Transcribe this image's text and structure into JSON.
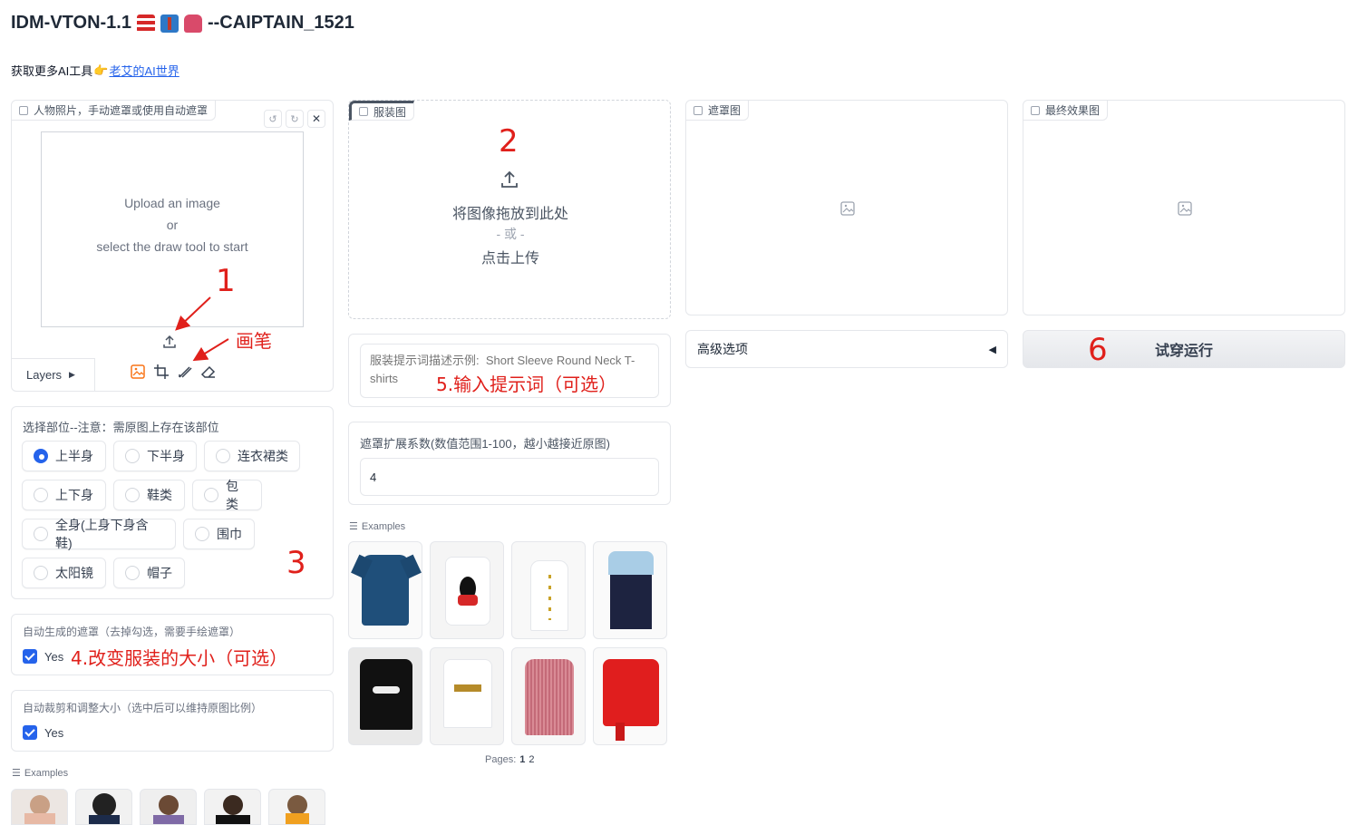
{
  "header": {
    "title": "IDM-VTON-1.1",
    "title_suffix": "--CAIPTAIN_1521",
    "subtitle_prefix": "获取更多AI工具",
    "subtitle_link": "老艾的AI世界"
  },
  "person_panel": {
    "label": "人物照片，手动遮罩或使用自动遮罩",
    "upload_line1": "Upload an image",
    "upload_line2": "or",
    "upload_line3": "select the draw tool to start",
    "layers_label": "Layers"
  },
  "garment_panel": {
    "label": "服装图",
    "drop_text": "将图像拖放到此处",
    "or_text": "- 或 -",
    "click_text": "点击上传"
  },
  "mask_panel": {
    "label": "遮罩图"
  },
  "result_panel": {
    "label": "最终效果图"
  },
  "advanced": {
    "label": "高级选项"
  },
  "run_button": {
    "label": "试穿运行"
  },
  "prompt": {
    "placeholder": "服装提示词描述示例:  Short Sleeve Round Neck T-shirts"
  },
  "mask_expand": {
    "label": "遮罩扩展系数(数值范围1-100，越小越接近原图)",
    "value": "4"
  },
  "region": {
    "label": "选择部位--注意：需原图上存在该部位",
    "options": [
      "上半身",
      "下半身",
      "连衣裙类",
      "上下身",
      "鞋类",
      "包类",
      "全身(上身下身含鞋)",
      "围巾",
      "太阳镜",
      "帽子"
    ],
    "selected": "上半身"
  },
  "auto_mask": {
    "label": "自动生成的遮罩（去掉勾选，需要手绘遮罩）",
    "checkbox_label": "Yes"
  },
  "auto_crop": {
    "label": "自动裁剪和调整大小（选中后可以维持原图比例）",
    "checkbox_label": "Yes"
  },
  "examples_label": "Examples",
  "garment_examples_label": "Examples",
  "pagination": {
    "label": "Pages:",
    "pages": [
      "1",
      "2"
    ]
  },
  "annotations": {
    "n1": "1",
    "n2": "2",
    "n3": "3",
    "n6": "6",
    "brush": "画笔",
    "step4": "4.改变服装的大小（可选）",
    "step5": "5.输入提示词（可选）"
  },
  "colors": {
    "accent": "#2563eb",
    "annotation": "#e0201b",
    "brush_tool": "#f97316"
  }
}
